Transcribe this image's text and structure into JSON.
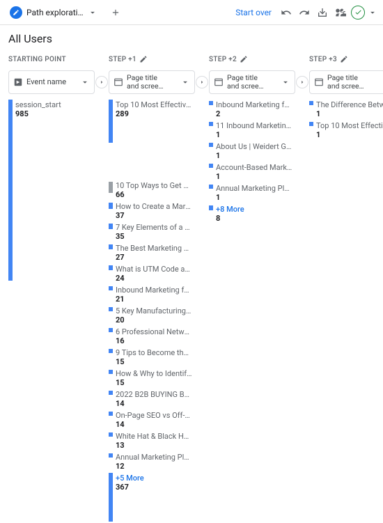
{
  "topbar": {
    "tab_label": "Path explorati…",
    "start_over": "Start over"
  },
  "title": "All Users",
  "cols": [
    {
      "header": "STARTING POINT",
      "selector": {
        "type": "event",
        "line1": "Event name"
      },
      "nodes": [
        {
          "label": "session_start",
          "value": "985",
          "tall": true
        }
      ]
    },
    {
      "header": "STEP +1",
      "selector": {
        "type": "page",
        "line1": "Page title",
        "line2": "and scree…"
      },
      "nodes": [
        {
          "label": "Top 10 Most Effective …",
          "value": "289",
          "tall": true
        },
        {
          "spacer": true
        },
        {
          "label": "10 Top Ways to Get M…",
          "value": "66",
          "gray": true,
          "h": 16
        },
        {
          "label": "How to Create a Mark…",
          "value": "37",
          "h": 9
        },
        {
          "label": "7 Key Elements of a Q…",
          "value": "35",
          "h": 8
        },
        {
          "label": "The Best Marketing Bu…",
          "value": "27",
          "h": 7
        },
        {
          "label": "What is UTM Code an…",
          "value": "24",
          "h": 7
        },
        {
          "label": "Inbound Marketing for …",
          "value": "21",
          "h": 6
        },
        {
          "label": "5 Key Manufacturing C…",
          "value": "20",
          "h": 6
        },
        {
          "label": "6 Professional Networ…",
          "value": "16",
          "h": 6
        },
        {
          "label": "9 Tips to Become the …",
          "value": "15",
          "h": 6
        },
        {
          "label": "How & Why to Identify …",
          "value": "15",
          "h": 6
        },
        {
          "label": "2022 B2B BUYING BE…",
          "value": "14",
          "h": 6
        },
        {
          "label": "On-Page SEO vs Off-P…",
          "value": "14",
          "h": 6
        },
        {
          "label": "White Hat & Black Hat …",
          "value": "13",
          "h": 6
        },
        {
          "label": "Annual Marketing Plan …",
          "value": "12",
          "h": 6
        },
        {
          "label": "+5 More",
          "value": "367",
          "more": true,
          "tall2": true,
          "h": 70
        }
      ]
    },
    {
      "header": "STEP +2",
      "selector": {
        "type": "page",
        "line1": "Page title",
        "line2": "and scree…"
      },
      "nodes": [
        {
          "label": "Inbound Marketing for …",
          "value": "2",
          "h": 6
        },
        {
          "label": "11 Inbound Marketing …",
          "value": "1",
          "h": 6
        },
        {
          "label": "About Us | Weidert Gro…",
          "value": "1",
          "h": 6
        },
        {
          "label": "Account-Based Market…",
          "value": "1",
          "h": 6
        },
        {
          "label": "Annual Marketing Plan …",
          "value": "1",
          "h": 6
        },
        {
          "label": "+8 More",
          "value": "8",
          "more": true,
          "h": 7
        }
      ]
    },
    {
      "header": "STEP +3",
      "selector": {
        "type": "page",
        "line1": "Page title",
        "line2": "and scree…"
      },
      "nodes": [
        {
          "label": "The Difference Betwee…",
          "value": "1",
          "h": 6
        },
        {
          "label": "Top 10 Most Effective …",
          "value": "1",
          "h": 6
        }
      ]
    }
  ]
}
